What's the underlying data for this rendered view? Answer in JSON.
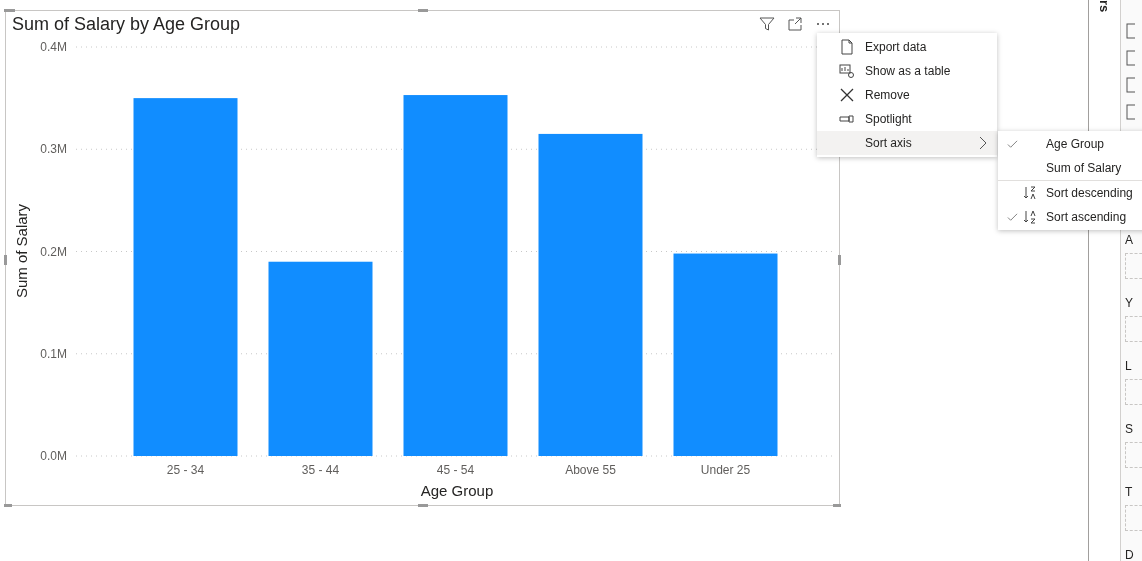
{
  "visual": {
    "title": "Sum of Salary by Age Group",
    "chart_data": {
      "type": "bar",
      "xlabel": "Age Group",
      "ylabel": "Sum of Salary",
      "categories": [
        "25 - 34",
        "35 - 44",
        "45 - 54",
        "Above 55",
        "Under 25"
      ],
      "values": [
        350000,
        190000,
        353000,
        315000,
        198000
      ],
      "grid": true,
      "ylim": [
        0,
        400000
      ],
      "yticks": [
        {
          "value": 0,
          "label": "0.0M"
        },
        {
          "value": 100000,
          "label": "0.1M"
        },
        {
          "value": 200000,
          "label": "0.2M"
        },
        {
          "value": 300000,
          "label": "0.3M"
        },
        {
          "value": 400000,
          "label": "0.4M"
        }
      ]
    }
  },
  "context_menu": {
    "items": [
      {
        "label": "Export data",
        "kind": "export",
        "selected": false
      },
      {
        "label": "Show as a table",
        "kind": "table",
        "selected": false
      },
      {
        "label": "Remove",
        "kind": "remove",
        "selected": false
      },
      {
        "label": "Spotlight",
        "kind": "spotlight",
        "selected": false
      },
      {
        "label": "Sort axis",
        "kind": "submenu",
        "selected": true
      }
    ]
  },
  "sort_submenu": {
    "items": [
      {
        "label": "Age Group",
        "kind": "field",
        "checked": true
      },
      {
        "label": "Sum of Salary",
        "kind": "field",
        "checked": false
      },
      {
        "label": "Sort descending",
        "kind": "descending",
        "checked": false
      },
      {
        "label": "Sort ascending",
        "kind": "ascending",
        "checked": true
      }
    ]
  },
  "side_panel": {
    "header": "rs",
    "labels": [
      "A",
      "Y",
      "L",
      "S",
      "T",
      "D"
    ]
  }
}
